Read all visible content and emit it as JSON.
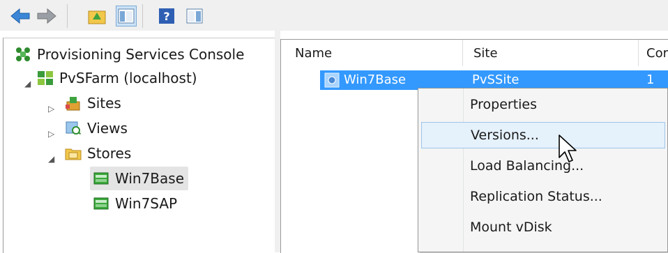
{
  "toolbar": {
    "buttons": [
      {
        "icon": "back-arrow-icon"
      },
      {
        "icon": "forward-arrow-icon"
      },
      {
        "icon": "up-folder-icon"
      },
      {
        "icon": "show-hide-tree-icon"
      },
      {
        "icon": "help-icon"
      },
      {
        "icon": "action-pane-icon"
      }
    ]
  },
  "tree": {
    "root": "Provisioning Services Console",
    "farm": "PvSFarm (localhost)",
    "sites": "Sites",
    "views": "Views",
    "stores": "Stores",
    "vdisks": [
      "Win7Base",
      "Win7SAP"
    ]
  },
  "list": {
    "columns": [
      "Name",
      "Site",
      "Cor"
    ],
    "row": {
      "name": "Win7Base",
      "site": "PvSSite",
      "count": "1"
    }
  },
  "context_menu": {
    "items": [
      "Properties",
      "Versions...",
      "Load Balancing...",
      "Replication Status...",
      "Mount vDisk"
    ],
    "hovered_index": 1
  },
  "colors": {
    "selection": "#3399ff",
    "menu_hover": "#e5f1fb",
    "toolbar_bg": "#f0f0f0"
  }
}
